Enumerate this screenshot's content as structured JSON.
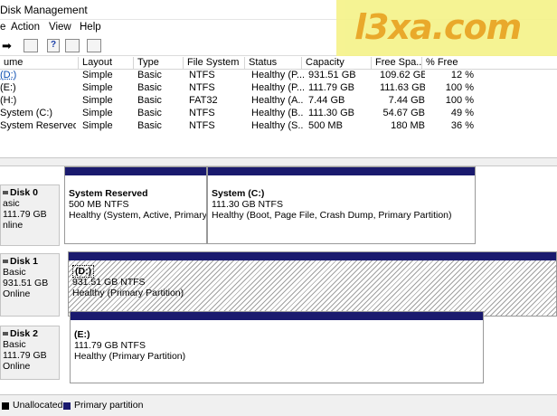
{
  "window": {
    "title": "Disk Management"
  },
  "menu": [
    "Action",
    "View",
    "Help"
  ],
  "watermark": "l3xa.com",
  "volume_table": {
    "headers": [
      "ume",
      "Layout",
      "Type",
      "File System",
      "Status",
      "Capacity",
      "Free Spa...",
      "% Free"
    ],
    "rows": [
      [
        "(D:)",
        "Simple",
        "Basic",
        "NTFS",
        "Healthy (P...",
        "931.51 GB",
        "109.62 GB",
        "12 %"
      ],
      [
        "(E:)",
        "Simple",
        "Basic",
        "NTFS",
        "Healthy (P...",
        "111.79 GB",
        "111.63 GB",
        "100 %"
      ],
      [
        "(H:)",
        "Simple",
        "Basic",
        "FAT32",
        "Healthy (A...",
        "7.44 GB",
        "7.44 GB",
        "100 %"
      ],
      [
        "System (C:)",
        "Simple",
        "Basic",
        "NTFS",
        "Healthy (B...",
        "111.30 GB",
        "54.67 GB",
        "49 %"
      ],
      [
        "System Reserved",
        "Simple",
        "Basic",
        "NTFS",
        "Healthy (S...",
        "500 MB",
        "180 MB",
        "36 %"
      ]
    ]
  },
  "disks": [
    {
      "name": "Disk 0",
      "type": "asic",
      "size": "111.79 GB",
      "status": "nline",
      "partitions": [
        {
          "name": "System Reserved",
          "size": "500 MB NTFS",
          "status": "Healthy (System, Active, Primary P"
        },
        {
          "name": "System  (C:)",
          "size": "111.30 GB NTFS",
          "status": "Healthy (Boot, Page File, Crash Dump, Primary Partition)"
        }
      ]
    },
    {
      "name": "Disk 1",
      "type": "Basic",
      "size": "931.51 GB",
      "status": "Online",
      "partitions": [
        {
          "name": "(D:)",
          "size": "931.51 GB NTFS",
          "status": "Healthy (Primary Partition)"
        }
      ]
    },
    {
      "name": "Disk 2",
      "type": "Basic",
      "size": "111.79 GB",
      "status": "Online",
      "partitions": [
        {
          "name": "(E:)",
          "size": "111.79 GB NTFS",
          "status": "Healthy (Primary Partition)"
        }
      ]
    }
  ],
  "legend": [
    {
      "label": "Unallocated",
      "color": "#000000"
    },
    {
      "label": "Primary partition",
      "color": "#1a1a6e"
    }
  ]
}
